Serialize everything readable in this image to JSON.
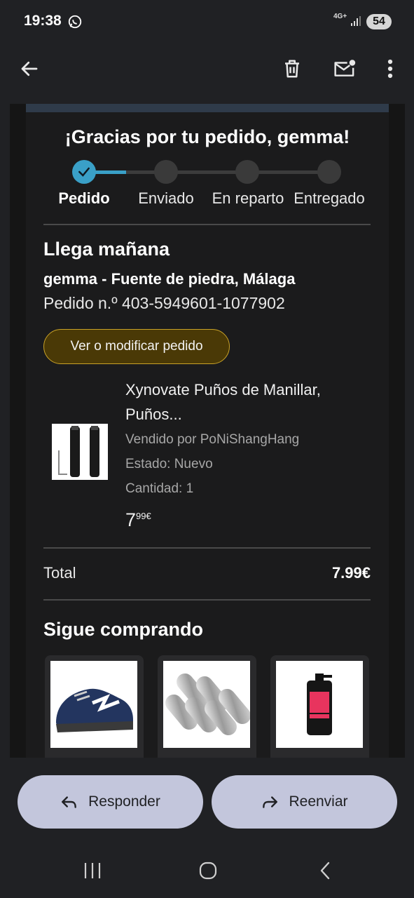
{
  "status_bar": {
    "time": "19:38",
    "network": "4G+",
    "battery": "54",
    "icons": [
      "whatsapp-icon",
      "signal-icon"
    ]
  },
  "app_bar": {
    "icons": [
      "back-arrow-icon",
      "trash-icon",
      "mark-unread-icon",
      "more-vertical-icon"
    ]
  },
  "email": {
    "heading": "¡Gracias por tu pedido, gemma!",
    "steps": [
      {
        "label": "Pedido",
        "done": true
      },
      {
        "label": "Enviado",
        "done": false
      },
      {
        "label": "En reparto",
        "done": false
      },
      {
        "label": "Entregado",
        "done": false
      }
    ],
    "progress_fraction": 0.08,
    "arrival": "Llega mañana",
    "address": "gemma - Fuente de piedra, Málaga",
    "order_number": "Pedido n.º 403-5949601-1077902",
    "view_order_button": "Ver o modificar pedido",
    "product": {
      "title": "Xynovate Puños de Manillar, Puños...",
      "seller": "Vendido por PoNiShangHang",
      "condition": "Estado: Nuevo",
      "quantity": "Cantidad: 1",
      "price_whole": "7",
      "price_fraction": "99€",
      "image": "bike-grips-image"
    },
    "total_label": "Total",
    "total_value": "7.99€",
    "keep_shopping": "Sigue comprando",
    "recommendations": [
      {
        "image": "safety-shoe-image"
      },
      {
        "image": "metal-cylinders-image"
      },
      {
        "image": "hair-dye-bottle-image"
      }
    ]
  },
  "actions": {
    "reply": "Responder",
    "forward": "Reenviar"
  },
  "navigation": {
    "icons": [
      "recent-apps-icon",
      "home-icon",
      "back-icon"
    ]
  },
  "colors": {
    "background": "#202124",
    "accent": "#3aa0c7",
    "button_gold": "#4a3906",
    "action_button": "#c3c6dc"
  }
}
